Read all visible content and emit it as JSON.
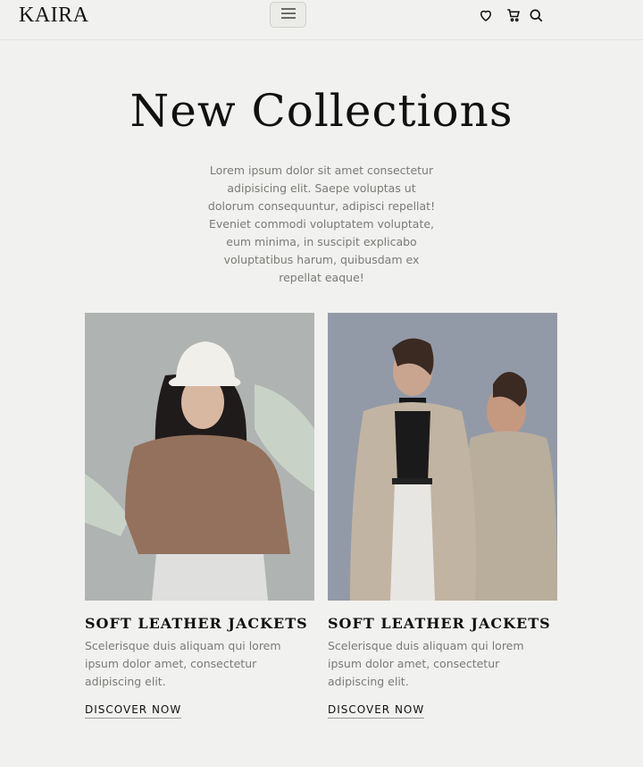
{
  "brand": {
    "logo_text": "KAIRA"
  },
  "header": {
    "menu_icon": "hamburger-icon",
    "icons": [
      "heart-icon",
      "cart-icon",
      "search-icon"
    ]
  },
  "intro": {
    "title": "New Collections",
    "description": "Lorem ipsum dolor sit amet consectetur adipisicing elit. Saepe voluptas ut dolorum consequuntur, adipisci repellat! Eveniet commodi voluptatem voluptate, eum minima, in suscipit explicabo voluptatibus harum, quibusdam ex repellat eaque!"
  },
  "cards": [
    {
      "title": "SOFT LEATHER JACKETS",
      "description": "Scelerisque duis aliquam qui lorem ipsum dolor amet, consectetur adipiscing elit.",
      "link_label": "DISCOVER NOW"
    },
    {
      "title": "SOFT LEATHER JACKETS",
      "description": "Scelerisque duis aliquam qui lorem ipsum dolor amet, consectetur adipiscing elit.",
      "link_label": "DISCOVER NOW"
    }
  ],
  "colors": {
    "background": "#f1f1ef",
    "text": "#111111",
    "muted_text": "#7a7a77"
  }
}
